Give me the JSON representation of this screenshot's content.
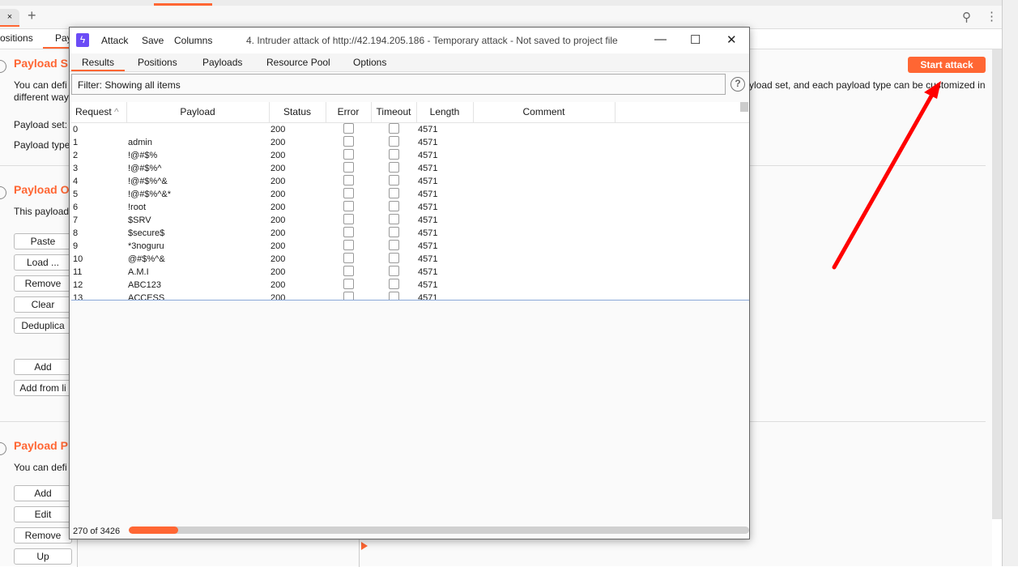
{
  "browser": {
    "tab_close": "×",
    "new_tab": "+",
    "search_icon": "⚲",
    "menu_icon": "⋮"
  },
  "intruder": {
    "subtabs": [
      "ositions",
      "Pay"
    ],
    "start_attack": "Start attack",
    "sections": [
      {
        "title": "Payload S",
        "desc": "You can defi",
        "desc2": "different way",
        "right_text": "yload set, and each payload type can be customized in",
        "labels": [
          "Payload set:",
          "Payload type"
        ]
      },
      {
        "title": "Payload O",
        "desc": "This payload",
        "buttons": [
          "Paste",
          "Load ...",
          "Remove",
          "Clear",
          "Deduplica",
          "Add",
          "Add from li"
        ]
      },
      {
        "title": "Payload P",
        "desc": "You can defi",
        "buttons": [
          "Add",
          "Edit",
          "Remove",
          "Up"
        ]
      }
    ]
  },
  "window": {
    "menu": [
      "Attack",
      "Save",
      "Columns"
    ],
    "title": "4. Intruder attack of http://42.194.205.186 - Temporary attack - Not saved to project file",
    "controls": {
      "minimize": "—",
      "maximize": "☐",
      "close": "✕"
    },
    "tabs": [
      "Results",
      "Positions",
      "Payloads",
      "Resource Pool",
      "Options"
    ],
    "active_tab": "Results",
    "filter": "Filter: Showing all items",
    "help": "?",
    "columns": [
      "Request",
      "Payload",
      "Status",
      "Error",
      "Timeout",
      "Length",
      "Comment"
    ],
    "sort_indicator": "^",
    "rows": [
      {
        "request": "0",
        "payload": "",
        "status": "200",
        "error": false,
        "timeout": false,
        "length": "4571"
      },
      {
        "request": "1",
        "payload": "admin",
        "status": "200",
        "error": false,
        "timeout": false,
        "length": "4571"
      },
      {
        "request": "2",
        "payload": "!@#$%",
        "status": "200",
        "error": false,
        "timeout": false,
        "length": "4571"
      },
      {
        "request": "3",
        "payload": "!@#$%^",
        "status": "200",
        "error": false,
        "timeout": false,
        "length": "4571"
      },
      {
        "request": "4",
        "payload": "!@#$%^&",
        "status": "200",
        "error": false,
        "timeout": false,
        "length": "4571"
      },
      {
        "request": "5",
        "payload": "!@#$%^&*",
        "status": "200",
        "error": false,
        "timeout": false,
        "length": "4571"
      },
      {
        "request": "6",
        "payload": "!root",
        "status": "200",
        "error": false,
        "timeout": false,
        "length": "4571"
      },
      {
        "request": "7",
        "payload": "$SRV",
        "status": "200",
        "error": false,
        "timeout": false,
        "length": "4571"
      },
      {
        "request": "8",
        "payload": "$secure$",
        "status": "200",
        "error": false,
        "timeout": false,
        "length": "4571"
      },
      {
        "request": "9",
        "payload": "*3noguru",
        "status": "200",
        "error": false,
        "timeout": false,
        "length": "4571"
      },
      {
        "request": "10",
        "payload": "@#$%^&",
        "status": "200",
        "error": false,
        "timeout": false,
        "length": "4571"
      },
      {
        "request": "11",
        "payload": "A.M.I",
        "status": "200",
        "error": false,
        "timeout": false,
        "length": "4571"
      },
      {
        "request": "12",
        "payload": "ABC123",
        "status": "200",
        "error": false,
        "timeout": false,
        "length": "4571"
      },
      {
        "request": "13",
        "payload": "ACCESS",
        "status": "200",
        "error": false,
        "timeout": false,
        "length": "4571"
      }
    ],
    "progress_text": "270 of 3426",
    "progress_fraction": 0.079
  },
  "colors": {
    "accent": "#ff6633",
    "logo": "#6b4cf6",
    "arrow": "#ff0000"
  }
}
